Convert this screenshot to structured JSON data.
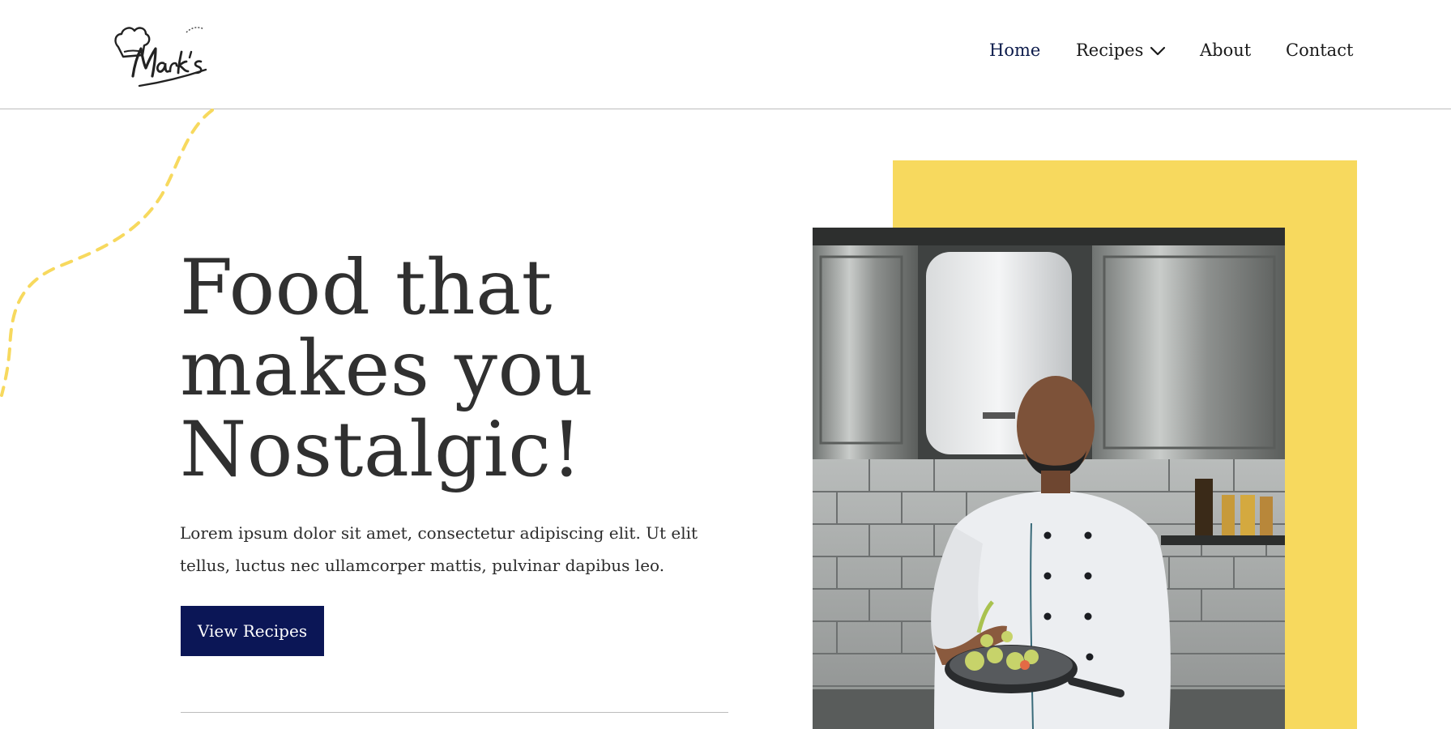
{
  "brand": {
    "logo_alt": "Mark's Kitchen",
    "accent_color": "#f7d95e",
    "primary_color": "#0b1656"
  },
  "nav": {
    "items": [
      {
        "label": "Home",
        "active": true
      },
      {
        "label": "Recipes",
        "has_dropdown": true
      },
      {
        "label": "About"
      },
      {
        "label": "Contact"
      }
    ]
  },
  "hero": {
    "title_lines": [
      "Food that",
      "makes you",
      "Nostalgic!"
    ],
    "description": "Lorem ipsum dolor sit amet, consectetur adipiscing elit. Ut elit tellus, luctus nec ullamcorper mattis, pulvinar dapibus leo.",
    "cta_label": "View Recipes",
    "image_alt": "Chef tossing vegetables in a pan in a professional kitchen"
  },
  "icons": {
    "logo": "chef-hat-logo-icon",
    "dropdown": "chevron-down-icon",
    "decoration": "dashed-curve-decoration"
  }
}
